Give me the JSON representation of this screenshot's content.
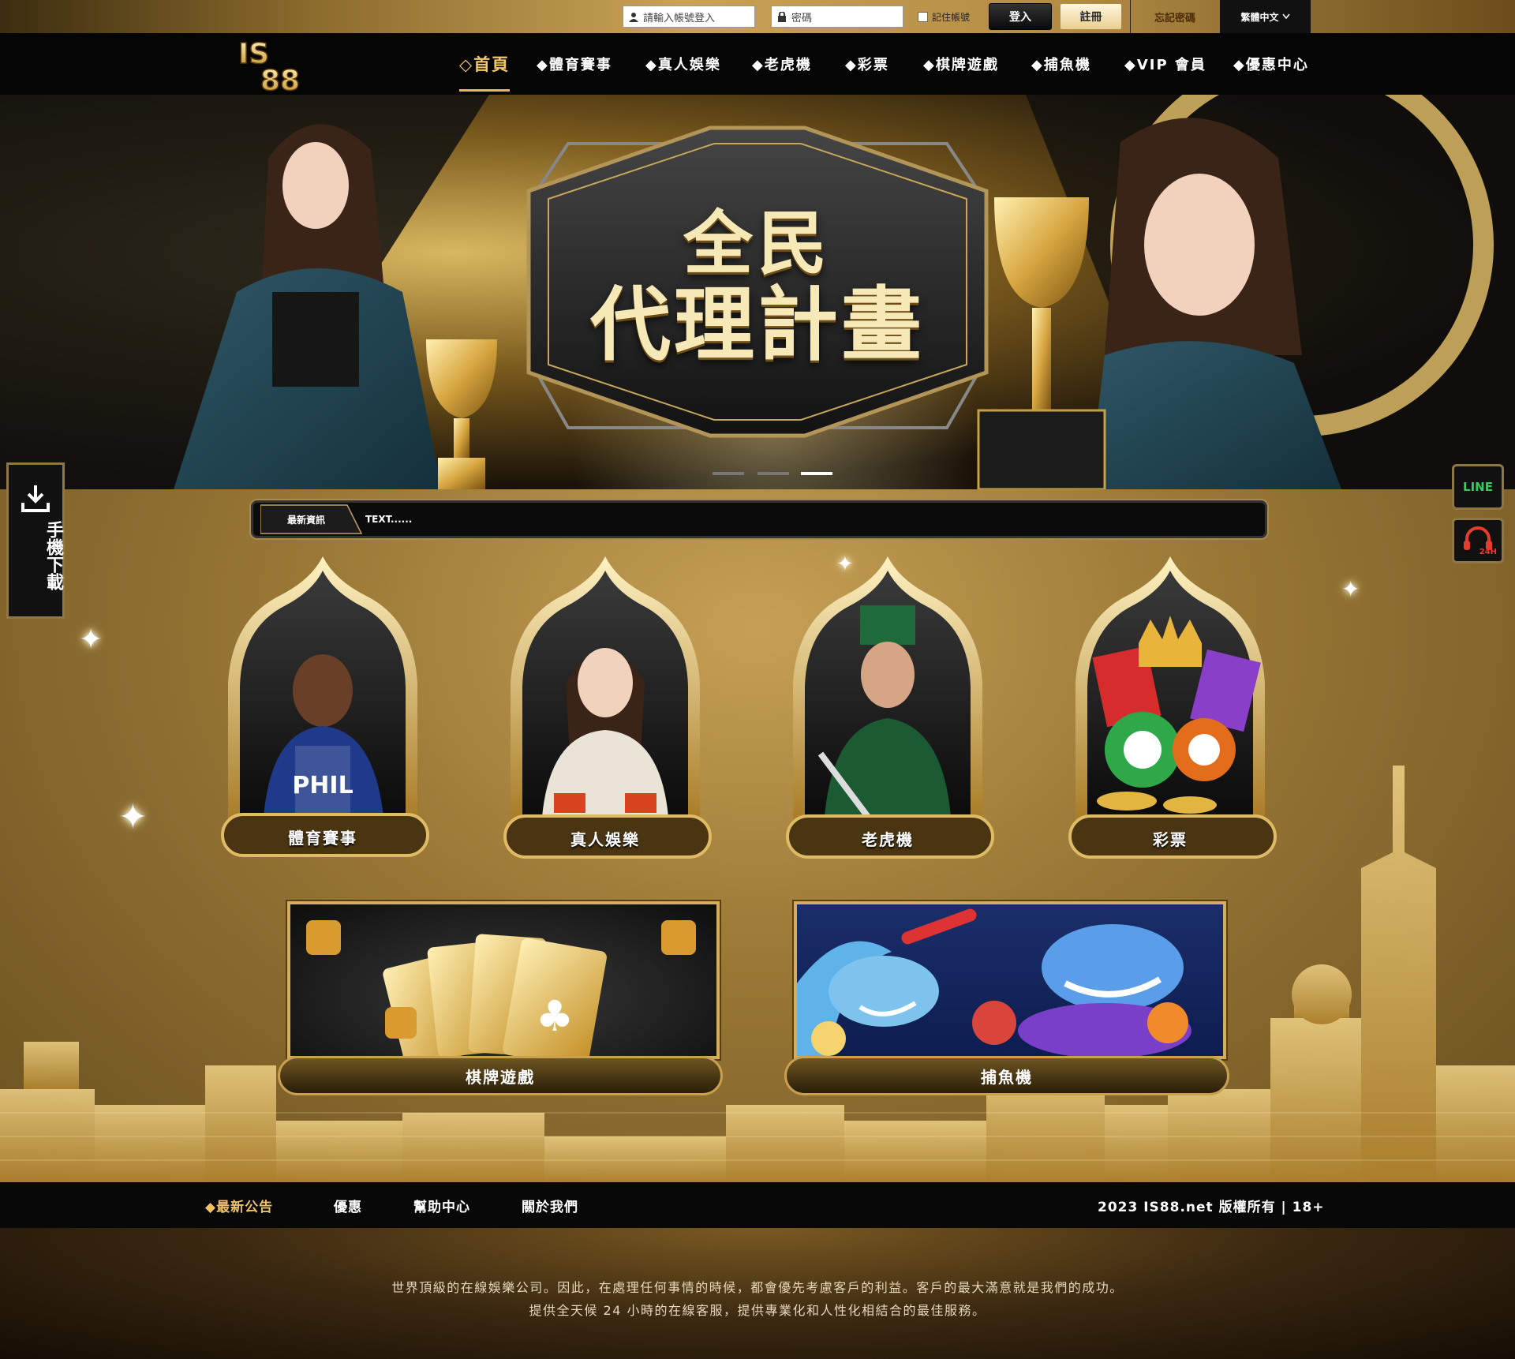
{
  "topbar": {
    "username_placeholder": "請輸入帳號登入",
    "password_placeholder": "密碼",
    "remember_label": "記住帳號",
    "login_label": "登入",
    "register_label": "註冊",
    "forgot_label": "忘記密碼",
    "language_label": "繁體中文"
  },
  "brand": {
    "logo_line1": "IS",
    "logo_line2": "88"
  },
  "nav": {
    "items": [
      {
        "label": "◇首頁"
      },
      {
        "label": "◆體育賽事"
      },
      {
        "label": "◆真人娛樂"
      },
      {
        "label": "◆老虎機"
      },
      {
        "label": "◆彩票"
      },
      {
        "label": "◆棋牌遊戲"
      },
      {
        "label": "◆捕魚機"
      },
      {
        "label": "◆VIP 會員"
      },
      {
        "label": "◆優惠中心"
      }
    ]
  },
  "banner": {
    "title_line1": "全民",
    "title_line2": "代理計畫",
    "slides": 3,
    "active_slide": 3
  },
  "news": {
    "label": "最新資訊",
    "text": "TEXT......"
  },
  "side": {
    "download_label": "手機下載",
    "line_label": "LINE",
    "support_label": "24H"
  },
  "categories": [
    {
      "label": "體育賽事"
    },
    {
      "label": "真人娛樂"
    },
    {
      "label": "老虎機"
    },
    {
      "label": "彩票"
    }
  ],
  "cards": [
    {
      "label": "棋牌遊戲"
    },
    {
      "label": "捕魚機"
    }
  ],
  "footer_nav": {
    "items": [
      {
        "label": "◆最新公告"
      },
      {
        "label": "優惠"
      },
      {
        "label": "幫助中心"
      },
      {
        "label": "關於我們"
      }
    ],
    "copyright": "2023 IS88.net 版權所有 | 18+"
  },
  "footer": {
    "line1": "世界頂級的在線娛樂公司。因此，在處理任何事情的時候，都會優先考慮客戶的利益。客戶的最大滿意就是我們的成功。",
    "line2": "提供全天候 24 小時的在線客服，提供專業化和人性化相結合的最佳服務。"
  },
  "colors": {
    "accent": "#e8b75a",
    "dark": "#050505",
    "gold": "#c9a04f"
  }
}
